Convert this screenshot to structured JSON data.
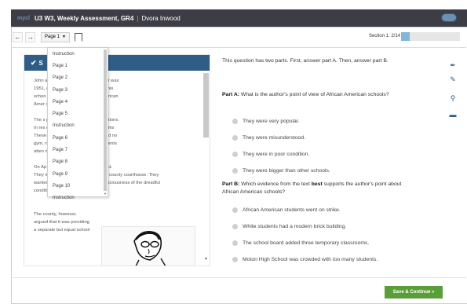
{
  "header": {
    "logo": "mycl",
    "title": "U3 W3, Weekly Assessment, GR4",
    "separator": "|",
    "student": "Dvora Inwood"
  },
  "toolbar": {
    "back_icon": "arrow-left-icon",
    "forward_icon": "arrow-right-icon",
    "page_select": "Page 1",
    "bookmark_icon": "bookmark-icon",
    "section_label": "Section 1: 2/14",
    "progress_fraction": 0.14
  },
  "dropdown": {
    "items": [
      "Instruction",
      "Page 1",
      "Page 2",
      "Page 3",
      "Page 4",
      "Page 5",
      "Instruction",
      "Page 6",
      "Page 7",
      "Page 8",
      "Page 9",
      "Page 10",
      "Instruction"
    ]
  },
  "passage": {
    "title_fragment": "S",
    "lines": [
      "John                              at he hated his school. The year was",
      "1951,                              oton High School in Virginia. This",
      "schoo                            udents. Now more than 450 African",
      "Amer                              o the school.",
      "",
      "The s                              protested the disgraceful conditions.",
      "In res                              dded three temporary classrooms",
      "These                              ant to last long. The school had no",
      "gym,                                rs. Just blocks away, white students",
      "atten                                rick building.",
      "",
      "On Ap                              r student leaders decided to act.",
      "They marched from the school to the county courthouse. They",
      "wanted to raise the community's consciousness of the dreadful",
      "conditions at their high school.",
      "",
      "",
      "The county, however,",
      "argued that it was providing",
      "a separate but equal school"
    ]
  },
  "question": {
    "intro": "This question has two parts. First, answer part A. Then, answer part B.",
    "part_a_label": "Part A:",
    "part_a_text": "What is the author's point of view of African American schools?",
    "part_a_options": [
      "They were very popular.",
      "They were misunderstood.",
      "They were in poor condition.",
      "They were bigger than other schools."
    ],
    "part_b_label": "Part B:",
    "part_b_text_1": "Which evidence from the text",
    "part_b_bold": "best",
    "part_b_text_2": "supports the author's point about African American schools?",
    "part_b_options": [
      "African American students went on strike.",
      "White students had a modern brick building.",
      "The school board added three temporary classrooms.",
      "Moton High School was crowded with too many students."
    ]
  },
  "tools": [
    "pen-icon",
    "highlighter-icon",
    "zoom-icon",
    "notes-icon"
  ],
  "footer": {
    "save_label": "Save & Continue",
    "save_arrow": "»"
  },
  "colors": {
    "header_bg": "#3d3d45",
    "passage_title_bg": "#2f5d86",
    "save_button": "#5a9e3a",
    "progress_fill": "#7fb6d9"
  }
}
